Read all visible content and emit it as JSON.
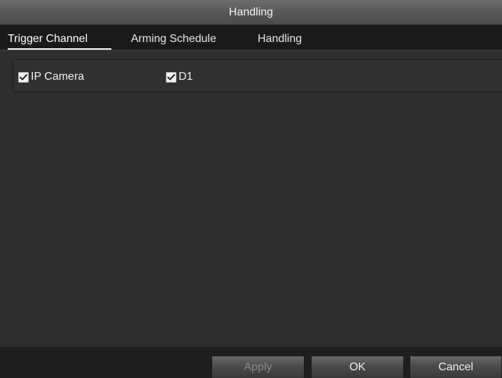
{
  "window": {
    "title": "Handling"
  },
  "tabs": [
    {
      "label": "Trigger Channel",
      "active": true
    },
    {
      "label": "Arming Schedule",
      "active": false
    },
    {
      "label": "Handling",
      "active": false
    }
  ],
  "channels": [
    {
      "label": "IP Camera",
      "checked": true
    },
    {
      "label": "D1",
      "checked": true
    }
  ],
  "buttons": {
    "apply": {
      "label": "Apply",
      "enabled": false
    },
    "ok": {
      "label": "OK",
      "enabled": true
    },
    "cancel": {
      "label": "Cancel",
      "enabled": true
    }
  },
  "colors": {
    "background": "#2e2e2e",
    "titlebar": "#585858",
    "tabbar": "#1a1a1a",
    "text": "#ffffff"
  },
  "icons": {
    "checkbox": "checkmark-icon"
  }
}
